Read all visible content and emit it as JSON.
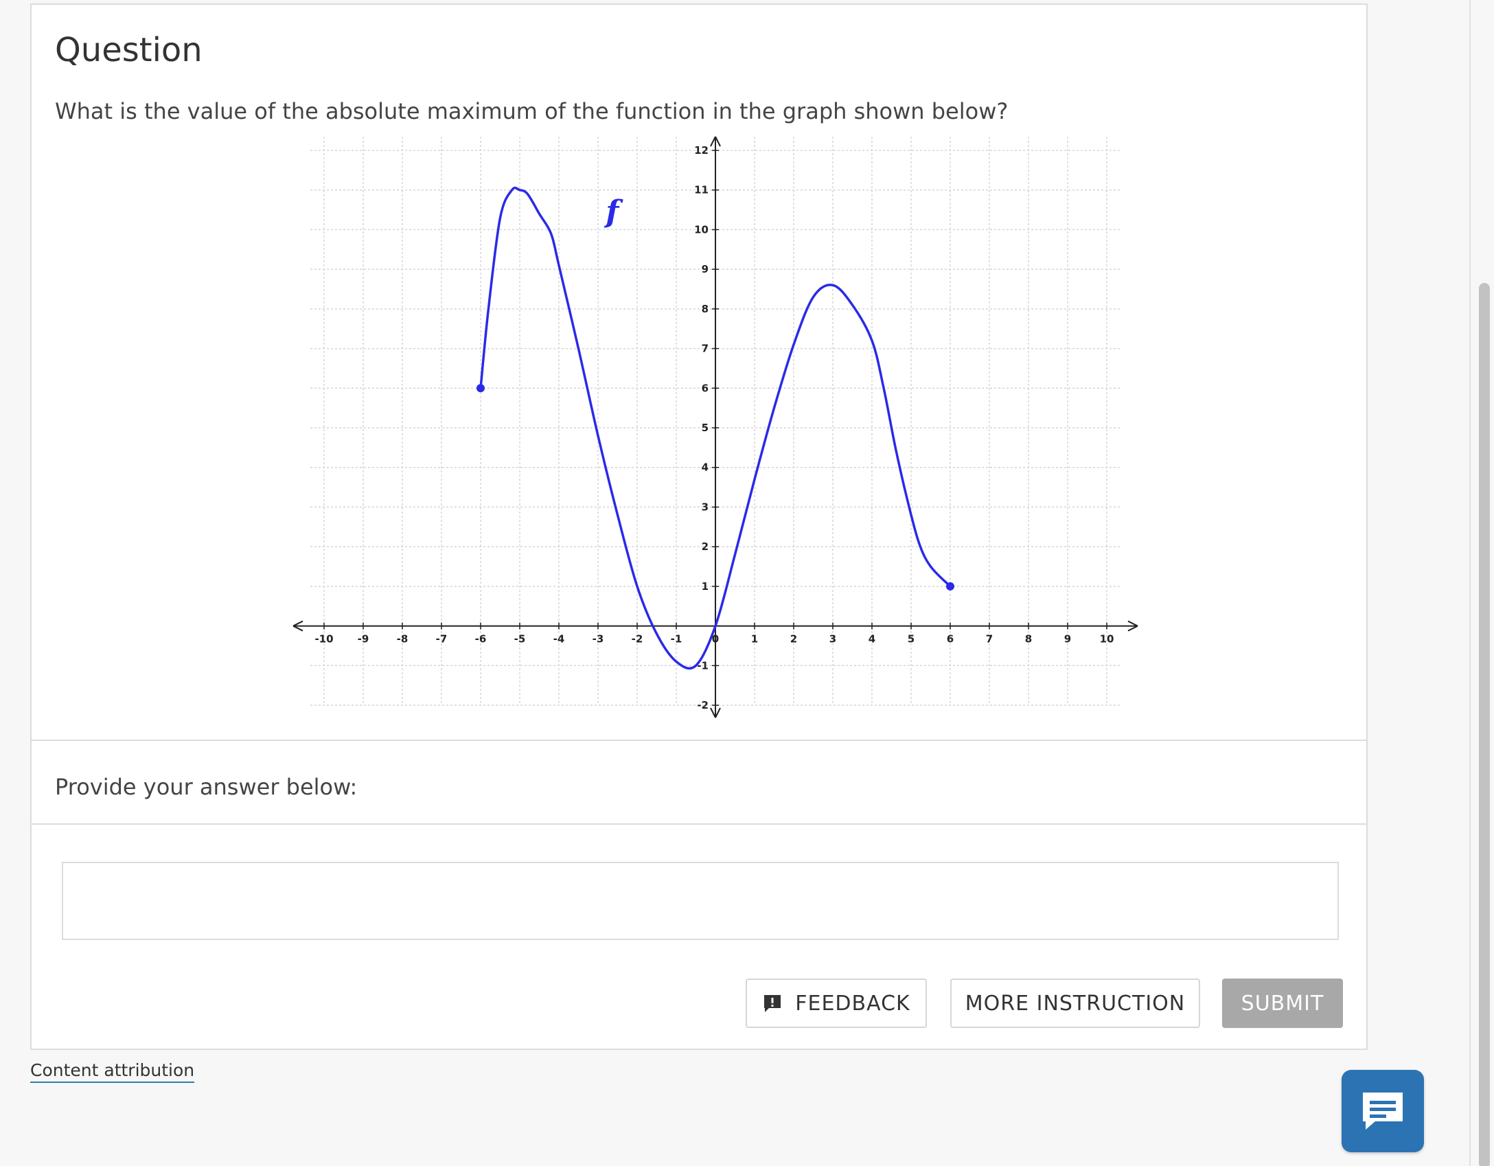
{
  "question": {
    "title": "Question",
    "text": "What is the value of the absolute maximum of the function in the graph shown below?"
  },
  "answer": {
    "label": "Provide your answer below:",
    "value": "",
    "placeholder": ""
  },
  "buttons": {
    "feedback": "FEEDBACK",
    "more_instruction": "MORE INSTRUCTION",
    "submit": "SUBMIT"
  },
  "footer": {
    "attribution": "Content attribution"
  },
  "icons": {
    "feedback": "feedback-icon",
    "chat": "chat-icon"
  },
  "colors": {
    "curve": "#2a2ae8",
    "submit_bg": "#a8a8a8",
    "chat_bg": "#2c73b3",
    "link_underline": "#2a7fae"
  },
  "chart_data": {
    "type": "line",
    "function_label": "f",
    "xlim": [
      -10,
      10
    ],
    "ylim": [
      -2,
      12
    ],
    "x_ticks": [
      "-10",
      "-9",
      "-8",
      "-7",
      "-6",
      "-5",
      "-4",
      "-3",
      "-2",
      "-1",
      "0",
      "1",
      "2",
      "3",
      "4",
      "5",
      "6",
      "7",
      "8",
      "9",
      "10"
    ],
    "y_ticks": [
      "-2",
      "-1",
      "1",
      "2",
      "3",
      "4",
      "5",
      "6",
      "7",
      "8",
      "9",
      "10",
      "11",
      "12"
    ],
    "grid": true,
    "series": [
      {
        "x": [
          -6,
          -5.8,
          -5.5,
          -5.2,
          -5,
          -4.8,
          -4.5,
          -4.2,
          -4,
          -3.5,
          -3,
          -2.5,
          -2,
          -1.5,
          -1,
          -0.5,
          0,
          0.5,
          1,
          1.5,
          2,
          2.5,
          3,
          3.5,
          4,
          4.3,
          4.6,
          4.9,
          5.2,
          5.5,
          6
        ],
        "y": [
          6,
          8,
          10.3,
          11,
          11,
          10.9,
          10.4,
          9.9,
          9.1,
          7.0,
          4.8,
          2.8,
          1.0,
          -0.2,
          -0.9,
          -1.0,
          0.0,
          1.8,
          3.7,
          5.5,
          7.1,
          8.3,
          8.6,
          8.1,
          7.2,
          6.0,
          4.5,
          3.2,
          2.1,
          1.5,
          1.0
        ]
      }
    ],
    "endpoints": [
      {
        "x": -6,
        "y": 6
      },
      {
        "x": 6,
        "y": 1
      }
    ]
  }
}
